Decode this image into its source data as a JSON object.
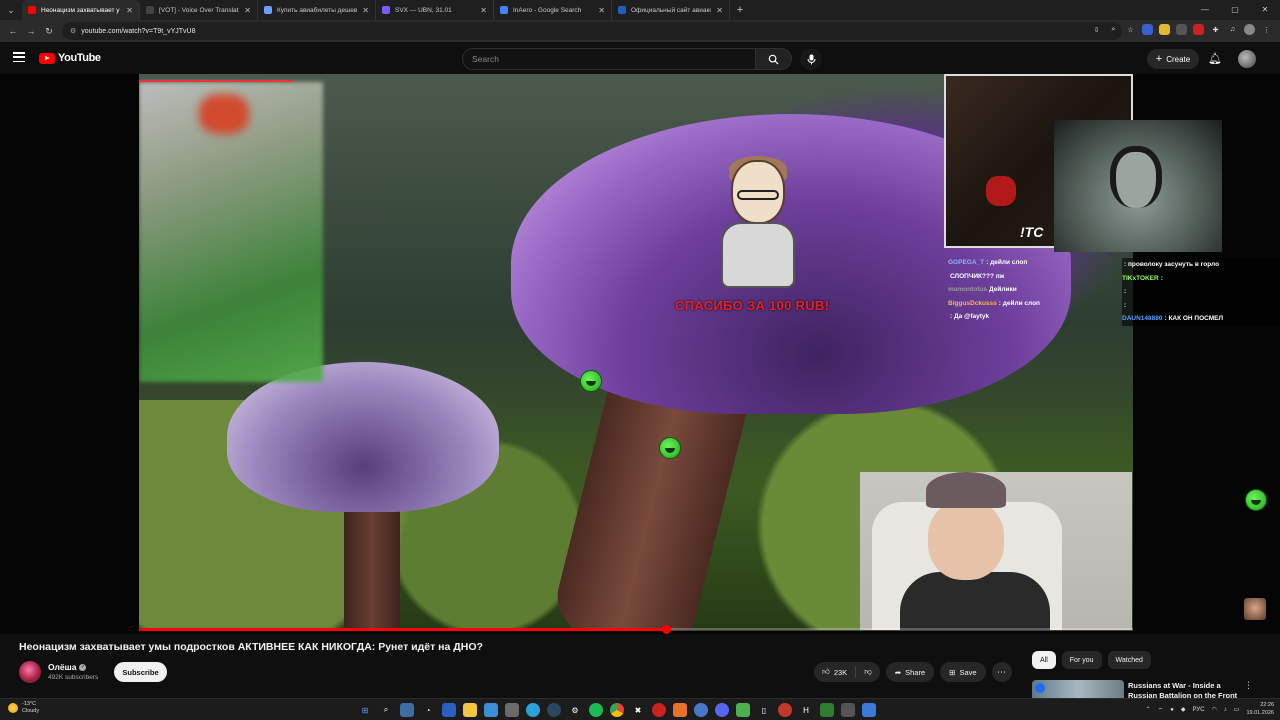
{
  "browser": {
    "tabs": [
      {
        "title": "Неонацизм захватывает у",
        "active": true,
        "favicon_color": "#ff0000"
      },
      {
        "title": "[VOT] - Voice Over Translation",
        "active": false,
        "favicon_color": "#444444"
      },
      {
        "title": "Купить авиабилеты дешево о",
        "active": false,
        "favicon_color": "#6aa0ff"
      },
      {
        "title": "SVX — UBN, 31.01",
        "active": false,
        "favicon_color": "#7a5af8"
      },
      {
        "title": "InAero - Google Search",
        "active": false,
        "favicon_color": "#4285f4"
      },
      {
        "title": "Официальный сайт авиакомп",
        "active": false,
        "favicon_color": "#1f5fbf"
      }
    ],
    "url": "youtube.com/watch?v=T9t_vYJTvU8"
  },
  "header": {
    "logo_text": "YouTube",
    "search_placeholder": "Search",
    "create_label": "Create"
  },
  "stream_overlay": {
    "donate_text": "СПАСИБО ЗА 100 RUB!",
    "cam_text": "!ТС",
    "chat_left": [
      {
        "user": "GGPEGA_T",
        "text": ": дейли слоп",
        "color": "#88b4ff"
      },
      {
        "user": "",
        "text": "СЛОПЧИК??? пж",
        "color": "#ff6fd0"
      },
      {
        "user": "mamontotus",
        "text": "Дейлики",
        "color": "#9a9a9a"
      },
      {
        "user": "BiggusDckusss",
        "text": ": дейли слоп",
        "color": "#ffb347"
      },
      {
        "user": "",
        "text": ": Да @faytyk",
        "color": "#ff6f6f"
      }
    ],
    "chat_right": [
      {
        "user": "",
        "text": ": проволоку засунуть в горло",
        "color": "#ff4fa0"
      },
      {
        "user": "TIKxTOKER",
        "text": ":",
        "color": "#9aff6a"
      },
      {
        "user": "",
        "text": ":",
        "color": "#ff4f8a"
      },
      {
        "user": "",
        "text": ":",
        "color": "#ff4f8a"
      },
      {
        "user": "DAUN148880",
        "text": ": КАК ОН ПОСМЕЛ",
        "color": "#5aa0ff"
      }
    ]
  },
  "player": {
    "progress": 0.53
  },
  "video": {
    "title": "Неонацизм захватывает умы подростков АКТИВНЕЕ КАК НИКОГДА: Рунет идёт на ДНО?",
    "channel": "Олёша",
    "subscribers": "492K subscribers",
    "subscribe_label": "Subscribe",
    "likes": "23K",
    "share_label": "Share",
    "save_label": "Save"
  },
  "sidebar": {
    "chips": [
      "All",
      "For you",
      "Watched"
    ],
    "recommendation_title": "Russians at War - Inside a Russian Battalion on the Front"
  },
  "taskbar": {
    "weather_temp": "-13°C",
    "weather_desc": "Cloudy",
    "lang": "РУС",
    "time": "22:26",
    "date": "19.01.2026"
  }
}
